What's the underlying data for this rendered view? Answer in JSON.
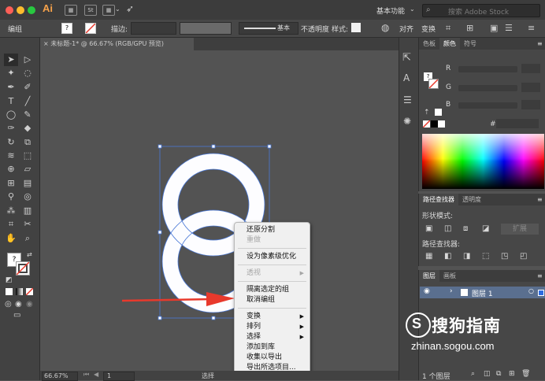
{
  "app": {
    "name": "Ai",
    "workspace": "基本功能",
    "search_placeholder": "搜索 Adobe Stock"
  },
  "control_bar": {
    "selection_label": "编组",
    "stroke_label": "描边:",
    "stroke_style": "基本",
    "opacity_label": "不透明度",
    "style_label": "样式:",
    "align_label": "对齐",
    "transform_label": "变换"
  },
  "document": {
    "tab_title": "未标题-1* @ 66.67% (RGB/GPU 预览)",
    "zoom": "66.67%",
    "artboard": "1",
    "status": "选择"
  },
  "color_panel": {
    "tabs": [
      "色板",
      "颜色",
      "符号"
    ],
    "active_tab": "颜色",
    "channels": [
      "R",
      "G",
      "B"
    ],
    "hex_label": "#"
  },
  "pathfinder_panel": {
    "tabs": [
      "路径查找器",
      "透明度"
    ],
    "shape_modes_label": "形状模式:",
    "expand_label": "扩展",
    "pathfinders_label": "路径查找器:"
  },
  "layers_panel": {
    "tabs": [
      "图层",
      "画板"
    ],
    "layer_name": "图层 1",
    "count": "1 个图层"
  },
  "context_menu": {
    "items": [
      {
        "label": "还原分割",
        "disabled": false,
        "submenu": false
      },
      {
        "label": "重做",
        "disabled": true,
        "submenu": false
      },
      {
        "label": "设为像素级优化",
        "disabled": false,
        "submenu": false
      },
      {
        "label": "透视",
        "disabled": true,
        "submenu": true
      },
      {
        "label": "隔离选定的组",
        "disabled": false,
        "submenu": false
      },
      {
        "label": "取消编组",
        "disabled": false,
        "submenu": false
      },
      {
        "label": "变换",
        "disabled": false,
        "submenu": true
      },
      {
        "label": "排列",
        "disabled": false,
        "submenu": true
      },
      {
        "label": "选择",
        "disabled": false,
        "submenu": true
      },
      {
        "label": "添加到库",
        "disabled": false,
        "submenu": false
      },
      {
        "label": "收集以导出",
        "disabled": false,
        "submenu": false
      },
      {
        "label": "导出所选项目...",
        "disabled": false,
        "submenu": false
      }
    ],
    "submenu_arrow": "▶"
  },
  "watermark": {
    "brand": "搜狗指南",
    "url": "zhinan.sogou.com"
  },
  "colors": {
    "accent_arrow": "#e8392c",
    "selection": "#4a78d6"
  }
}
